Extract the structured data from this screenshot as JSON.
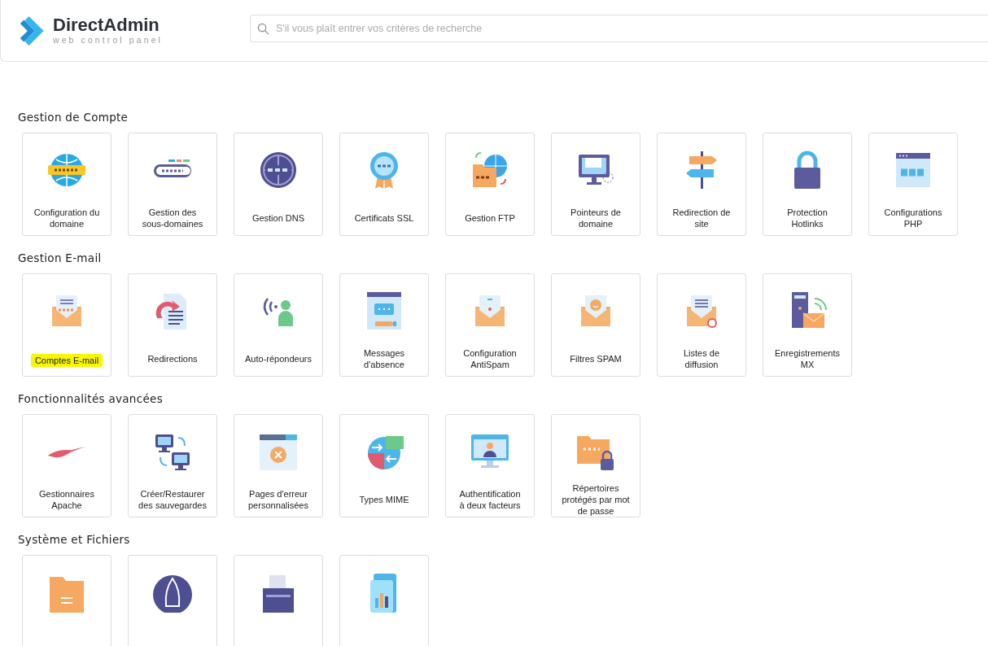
{
  "brand": {
    "name": "DirectAdmin",
    "tagline": "web control panel"
  },
  "search": {
    "placeholder": "S'il vous plaît entrer vos critères de recherche"
  },
  "sections": [
    {
      "title": "Gestion de Compte",
      "items": [
        {
          "label": "Configuration du domaine",
          "highlighted": false
        },
        {
          "label": "Gestion des sous-domaines",
          "highlighted": false
        },
        {
          "label": "Gestion DNS",
          "highlighted": false
        },
        {
          "label": "Certificats SSL",
          "highlighted": false
        },
        {
          "label": "Gestion FTP",
          "highlighted": false
        },
        {
          "label": "Pointeurs de domaine",
          "highlighted": false
        },
        {
          "label": "Redirection de site",
          "highlighted": false
        },
        {
          "label": "Protection Hotlinks",
          "highlighted": false
        },
        {
          "label": "Configurations PHP",
          "highlighted": false
        }
      ]
    },
    {
      "title": "Gestion E-mail",
      "items": [
        {
          "label": "Comptes E-mail",
          "highlighted": true
        },
        {
          "label": "Redirections",
          "highlighted": false
        },
        {
          "label": "Auto-répondeurs",
          "highlighted": false
        },
        {
          "label": "Messages d'absence",
          "highlighted": false
        },
        {
          "label": "Configuration AntiSpam",
          "highlighted": false
        },
        {
          "label": "Filtres SPAM",
          "highlighted": false
        },
        {
          "label": "Listes de diffusion",
          "highlighted": false
        },
        {
          "label": "Enregistrements MX",
          "highlighted": false
        }
      ]
    },
    {
      "title": "Fonctionnalités avancées",
      "items": [
        {
          "label": "Gestionnaires Apache",
          "highlighted": false
        },
        {
          "label": "Créer/Restaurer des sauvegardes",
          "highlighted": false
        },
        {
          "label": "Pages d'erreur personnalisées",
          "highlighted": false
        },
        {
          "label": "Types MIME",
          "highlighted": false
        },
        {
          "label": "Authentification à deux facteurs",
          "highlighted": false
        },
        {
          "label": "Répertoires protégés par mot de passe",
          "highlighted": false
        }
      ]
    },
    {
      "title": "Système et Fichiers",
      "items": [
        {
          "highlighted": false
        },
        {
          "highlighted": false
        },
        {
          "highlighted": false
        },
        {
          "highlighted": false
        }
      ]
    }
  ]
}
